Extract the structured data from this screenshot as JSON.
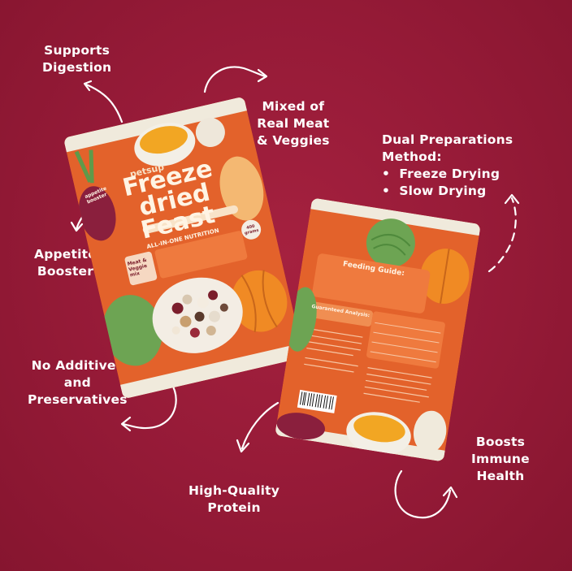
{
  "colors": {
    "background": "#9b1d3a",
    "accent_orange": "#e8672c",
    "accent_green": "#5e9a4a",
    "text": "#ffffff"
  },
  "callouts": {
    "supports_digestion": [
      "Supports",
      "Digestion"
    ],
    "mixed_meat": [
      "Mixed of",
      "Real Meat",
      "& Veggies"
    ],
    "dual_prep": {
      "title": [
        "Dual Preparations",
        "Method:"
      ],
      "items": [
        "Freeze Drying",
        "Slow Drying"
      ],
      "bullet": "•"
    },
    "appetite": [
      "Appetite",
      "Booster"
    ],
    "no_additives": [
      "No Additives",
      "and",
      "Preservatives"
    ],
    "protein": [
      "High-Quality",
      "Protein"
    ],
    "immune": [
      "Boosts",
      "Immune",
      "Health"
    ]
  },
  "front_pack": {
    "brand": "petsup",
    "title_lines": [
      "Freeze",
      "dried",
      "Feast"
    ],
    "subtitle": "ALL-IN-ONE NUTRITION",
    "badge": "appetite booster",
    "weight": "400 grams",
    "recipe": "Meat & Veggie mix"
  },
  "back_pack": {
    "heading": "Feeding Guide:",
    "analysis_heading": "Guaranteed Analysis:"
  },
  "icons": [
    "curved-arrow-icon",
    "dashed-arrow-icon"
  ]
}
